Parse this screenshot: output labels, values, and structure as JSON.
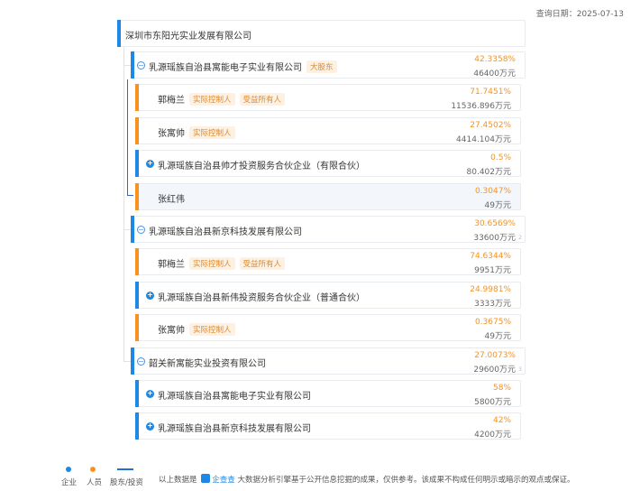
{
  "query_date": "查询日期：2025-07-13",
  "root": {
    "name": "深圳市东阳光实业发展有限公司"
  },
  "rows": [
    {
      "level": 1,
      "type": "company",
      "icon": "collapse",
      "name": "乳源瑶族自治县寓能电子实业有限公司",
      "tags": [
        "大股东"
      ],
      "percent": "42.3358%",
      "amount": "46400万元"
    },
    {
      "level": 2,
      "type": "person",
      "name": "郭梅兰",
      "tags": [
        "实际控制人",
        "受益所有人"
      ],
      "percent": "71.7451%",
      "amount": "11536.896万元"
    },
    {
      "level": 2,
      "type": "person",
      "name": "张寓帅",
      "tags": [
        "实际控制人"
      ],
      "percent": "27.4502%",
      "amount": "4414.104万元"
    },
    {
      "level": 2,
      "type": "company",
      "icon": "expand",
      "name": "乳源瑶族自治县帅才投资服务合伙企业（有限合伙）",
      "tags": [],
      "percent": "0.5%",
      "amount": "80.402万元"
    },
    {
      "level": 2,
      "type": "person",
      "highlight": true,
      "name": "张红伟",
      "tags": [],
      "percent": "0.3047%",
      "amount": "49万元"
    },
    {
      "level": 1,
      "type": "company",
      "icon": "collapse",
      "name": "乳源瑶族自治县新京科技发展有限公司",
      "tags": [],
      "percent": "30.6569%",
      "amount": "33600万元",
      "corner": "2"
    },
    {
      "level": 2,
      "type": "person",
      "name": "郭梅兰",
      "tags": [
        "实际控制人",
        "受益所有人"
      ],
      "percent": "74.6344%",
      "amount": "9951万元"
    },
    {
      "level": 2,
      "type": "company",
      "icon": "expand",
      "name": "乳源瑶族自治县新伟投资服务合伙企业（普通合伙）",
      "tags": [],
      "percent": "24.9981%",
      "amount": "3333万元"
    },
    {
      "level": 2,
      "type": "person",
      "name": "张寓帅",
      "tags": [
        "实际控制人"
      ],
      "percent": "0.3675%",
      "amount": "49万元"
    },
    {
      "level": 1,
      "type": "company",
      "icon": "collapse",
      "name": "韶关新寓能实业投资有限公司",
      "tags": [],
      "percent": "27.0073%",
      "amount": "29600万元",
      "corner": "3"
    },
    {
      "level": 2,
      "type": "company",
      "icon": "expand",
      "name": "乳源瑶族自治县寓能电子实业有限公司",
      "tags": [],
      "percent": "58%",
      "amount": "5800万元"
    },
    {
      "level": 2,
      "type": "company",
      "icon": "expand",
      "name": "乳源瑶族自治县新京科技发展有限公司",
      "tags": [],
      "percent": "42%",
      "amount": "4200万元"
    }
  ],
  "legend": {
    "company": "企业",
    "person": "人员",
    "shareholder": "股东/投资"
  },
  "footer": {
    "prefix": "以上数据是",
    "brand": "企查查",
    "suffix": "大数据分析引擎基于公开信息挖掘的成果，仅供参考。该成果不构成任何明示或暗示的观点或保证。"
  },
  "colors": {
    "company": "#1e88e5",
    "person": "#f7921e",
    "percent": "#f39325",
    "tag_bg": "#fdf1e3"
  }
}
